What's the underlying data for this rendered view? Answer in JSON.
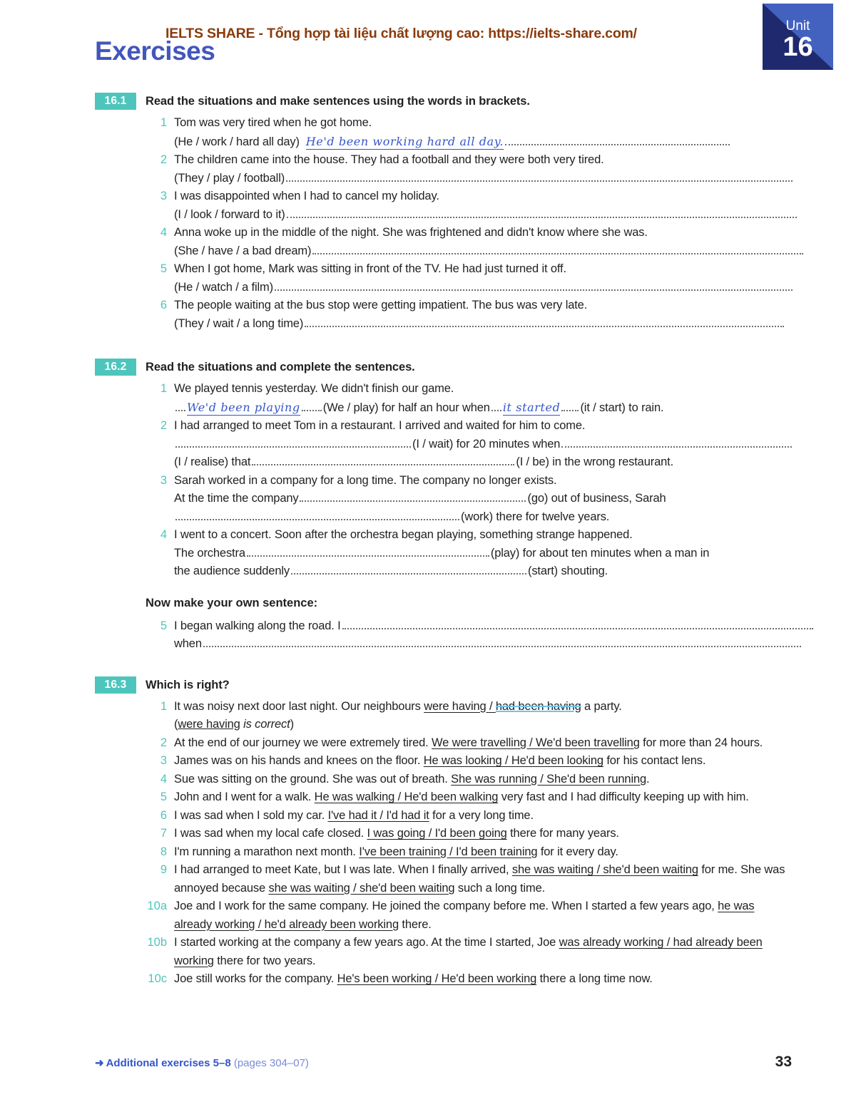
{
  "header": {
    "watermark": "IELTS SHARE - Tổng hợp tài liệu chất lượng cao: https://ielts-share.com/",
    "title": "Exercises",
    "unit_label": "Unit",
    "unit_number": "16",
    "accent_teal": "#4ec5bc",
    "accent_blue": "#3355cc",
    "badge_navy": "#1f2a6e",
    "badge_blue": "#4362c0",
    "watermark_color": "#8a3a0b"
  },
  "sections": [
    {
      "badge": "16.1",
      "title": "Read the situations and make sentences using the words in brackets.",
      "items": [
        {
          "num": "1",
          "line1": "Tom was very tired when he got home.",
          "cue": "(He / work / hard all day)",
          "answer": "He'd been working hard all day."
        },
        {
          "num": "2",
          "line1": "The children came into the house.  They had a football and they were both very tired.",
          "cue": "(They / play / football)",
          "answer": ""
        },
        {
          "num": "3",
          "line1": "I was disappointed when I had to cancel my holiday.",
          "cue": "(I / look / forward to it)",
          "answer": ""
        },
        {
          "num": "4",
          "line1": "Anna woke up in the middle of the night.  She was frightened and didn't know where she was.",
          "cue": "(She / have / a bad dream)",
          "answer": ""
        },
        {
          "num": "5",
          "line1": "When I got home, Mark was sitting in front of the TV.  He had just turned it off.",
          "cue": "(He / watch / a film)",
          "answer": ""
        },
        {
          "num": "6",
          "line1": "The people waiting at the bus stop were getting impatient.  The bus was very late.",
          "cue": "(They / wait / a long time)",
          "answer": ""
        }
      ]
    },
    {
      "badge": "16.2",
      "title": "Read the situations and complete the sentences.",
      "subheading": "Now make your own sentence:",
      "items": [
        {
          "num": "1",
          "line1": "We played tennis yesterday.  We didn't finish our game.",
          "ans_a": "We'd been playing",
          "mid_a": "(We / play) for half an hour when",
          "ans_b": "it started",
          "tail": "(it / start) to rain."
        },
        {
          "num": "2",
          "line1": "I had arranged to meet Tom in a restaurant.  I arrived and waited for him to come.",
          "mid_a": "(I / wait) for 20 minutes when",
          "lead_b": "(I / realise) that",
          "tail": "(I / be) in the wrong restaurant."
        },
        {
          "num": "3",
          "line1": "Sarah worked in a company for a long time.  The company no longer exists.",
          "lead_a": "At the time the company",
          "mid_a": "(go) out of business, Sarah",
          "tail": "(work) there for twelve years."
        },
        {
          "num": "4",
          "line1": "I went to a concert.  Soon after the orchestra began playing, something strange happened.",
          "lead_a": "The orchestra",
          "mid_a": "(play) for about ten minutes when a man in",
          "lead_b": "the audience suddenly",
          "tail": "(start) shouting."
        },
        {
          "num": "5",
          "lead_a": "I began walking along the road.  I",
          "lead_b": "when"
        }
      ]
    },
    {
      "badge": "16.3",
      "title": "Which is right?",
      "items": [
        {
          "num": "1",
          "pre": "It was noisy next door last night.  Our neighbours ",
          "opt_keep": "were having",
          "sep": " / ",
          "opt_strike": "had been having",
          "post": " a party.",
          "note_opt": "were having",
          "note_italic": " is correct",
          "note_close": ")"
        },
        {
          "num": "2",
          "pre": "At the end of our journey we were extremely tired.  ",
          "opt": "We were travelling / We'd been travelling",
          "post": " for more than 24 hours."
        },
        {
          "num": "3",
          "pre": "James was on his hands and knees on the floor.  ",
          "opt": "He was looking / He'd been looking",
          "post": " for his contact lens."
        },
        {
          "num": "4",
          "pre": "Sue was sitting on the ground.  She was out of breath.  ",
          "opt": "She was running / She'd been running",
          "post": "."
        },
        {
          "num": "5",
          "pre": "John and I went for a walk.  ",
          "opt": "He was walking / He'd been walking",
          "post": " very fast and I had difficulty keeping up with him."
        },
        {
          "num": "6",
          "pre": "I was sad when I sold my car.  ",
          "opt": "I've had it / I'd had it",
          "post": " for a very long time."
        },
        {
          "num": "7",
          "pre": "I was sad when my local cafe closed.  ",
          "opt": "I was going / I'd been going",
          "post": " there for many years."
        },
        {
          "num": "8",
          "pre": "I'm running a marathon next month.  ",
          "opt": "I've been training / I'd been training",
          "post": " for it every day."
        },
        {
          "num": "9",
          "pre": "I had arranged to meet Kate, but I was late.  When I finally arrived, ",
          "opt": "she was waiting / she'd been waiting",
          "mid": " for me.  She was annoyed because ",
          "opt2": "she was waiting / she'd been waiting",
          "post": " such a long time."
        },
        {
          "num": "10a",
          "pre": "Joe and I work for the same company.  He joined the company before me.  When I started a few years ago, ",
          "opt": "he was already working / he'd already been working",
          "post": " there."
        },
        {
          "num": "10b",
          "pre": "I started working at the company a few years ago.  At the time I started, Joe ",
          "opt": "was already working / had already been working",
          "post": " there for two years."
        },
        {
          "num": "10c",
          "pre": "Joe still works for the company.  ",
          "opt": "He's been working / He'd been working",
          "post": " there a long time now."
        }
      ]
    }
  ],
  "footer": {
    "arrow": "➜",
    "link_text": "Additional exercises 5–8",
    "pages": " (pages 304–07)",
    "page_number": "33"
  }
}
